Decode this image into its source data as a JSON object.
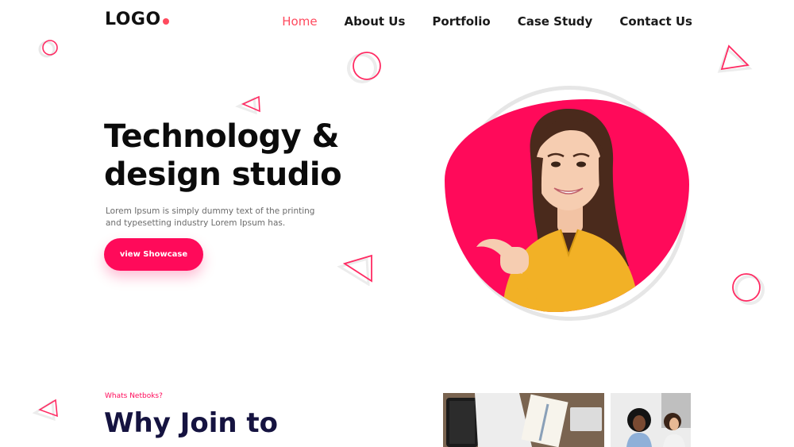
{
  "colors": {
    "accent": "#ff0a5a",
    "nav_active": "#ff4a5e",
    "heading_dark": "#151340"
  },
  "header": {
    "logo_text": "LOGO",
    "nav": [
      {
        "label": "Home",
        "active": true
      },
      {
        "label": "About Us",
        "active": false
      },
      {
        "label": "Portfolio",
        "active": false
      },
      {
        "label": "Case Study",
        "active": false
      },
      {
        "label": "Contact Us",
        "active": false
      }
    ]
  },
  "hero": {
    "title_line1": "Technology &",
    "title_line2": "design studio",
    "description": "Lorem Ipsum is simply dummy text of the printing and typesetting industry Lorem Ipsum has.",
    "cta_label": "view Showcase",
    "image_icon": "woman-pointing-photo"
  },
  "section2": {
    "eyebrow": "Whats Netboks?",
    "heading": "Why Join to",
    "images": [
      "desk-devices-photo",
      "team-meeting-photo"
    ]
  },
  "decor_icons": [
    "circle-outline-icon",
    "triangle-outline-icon"
  ]
}
